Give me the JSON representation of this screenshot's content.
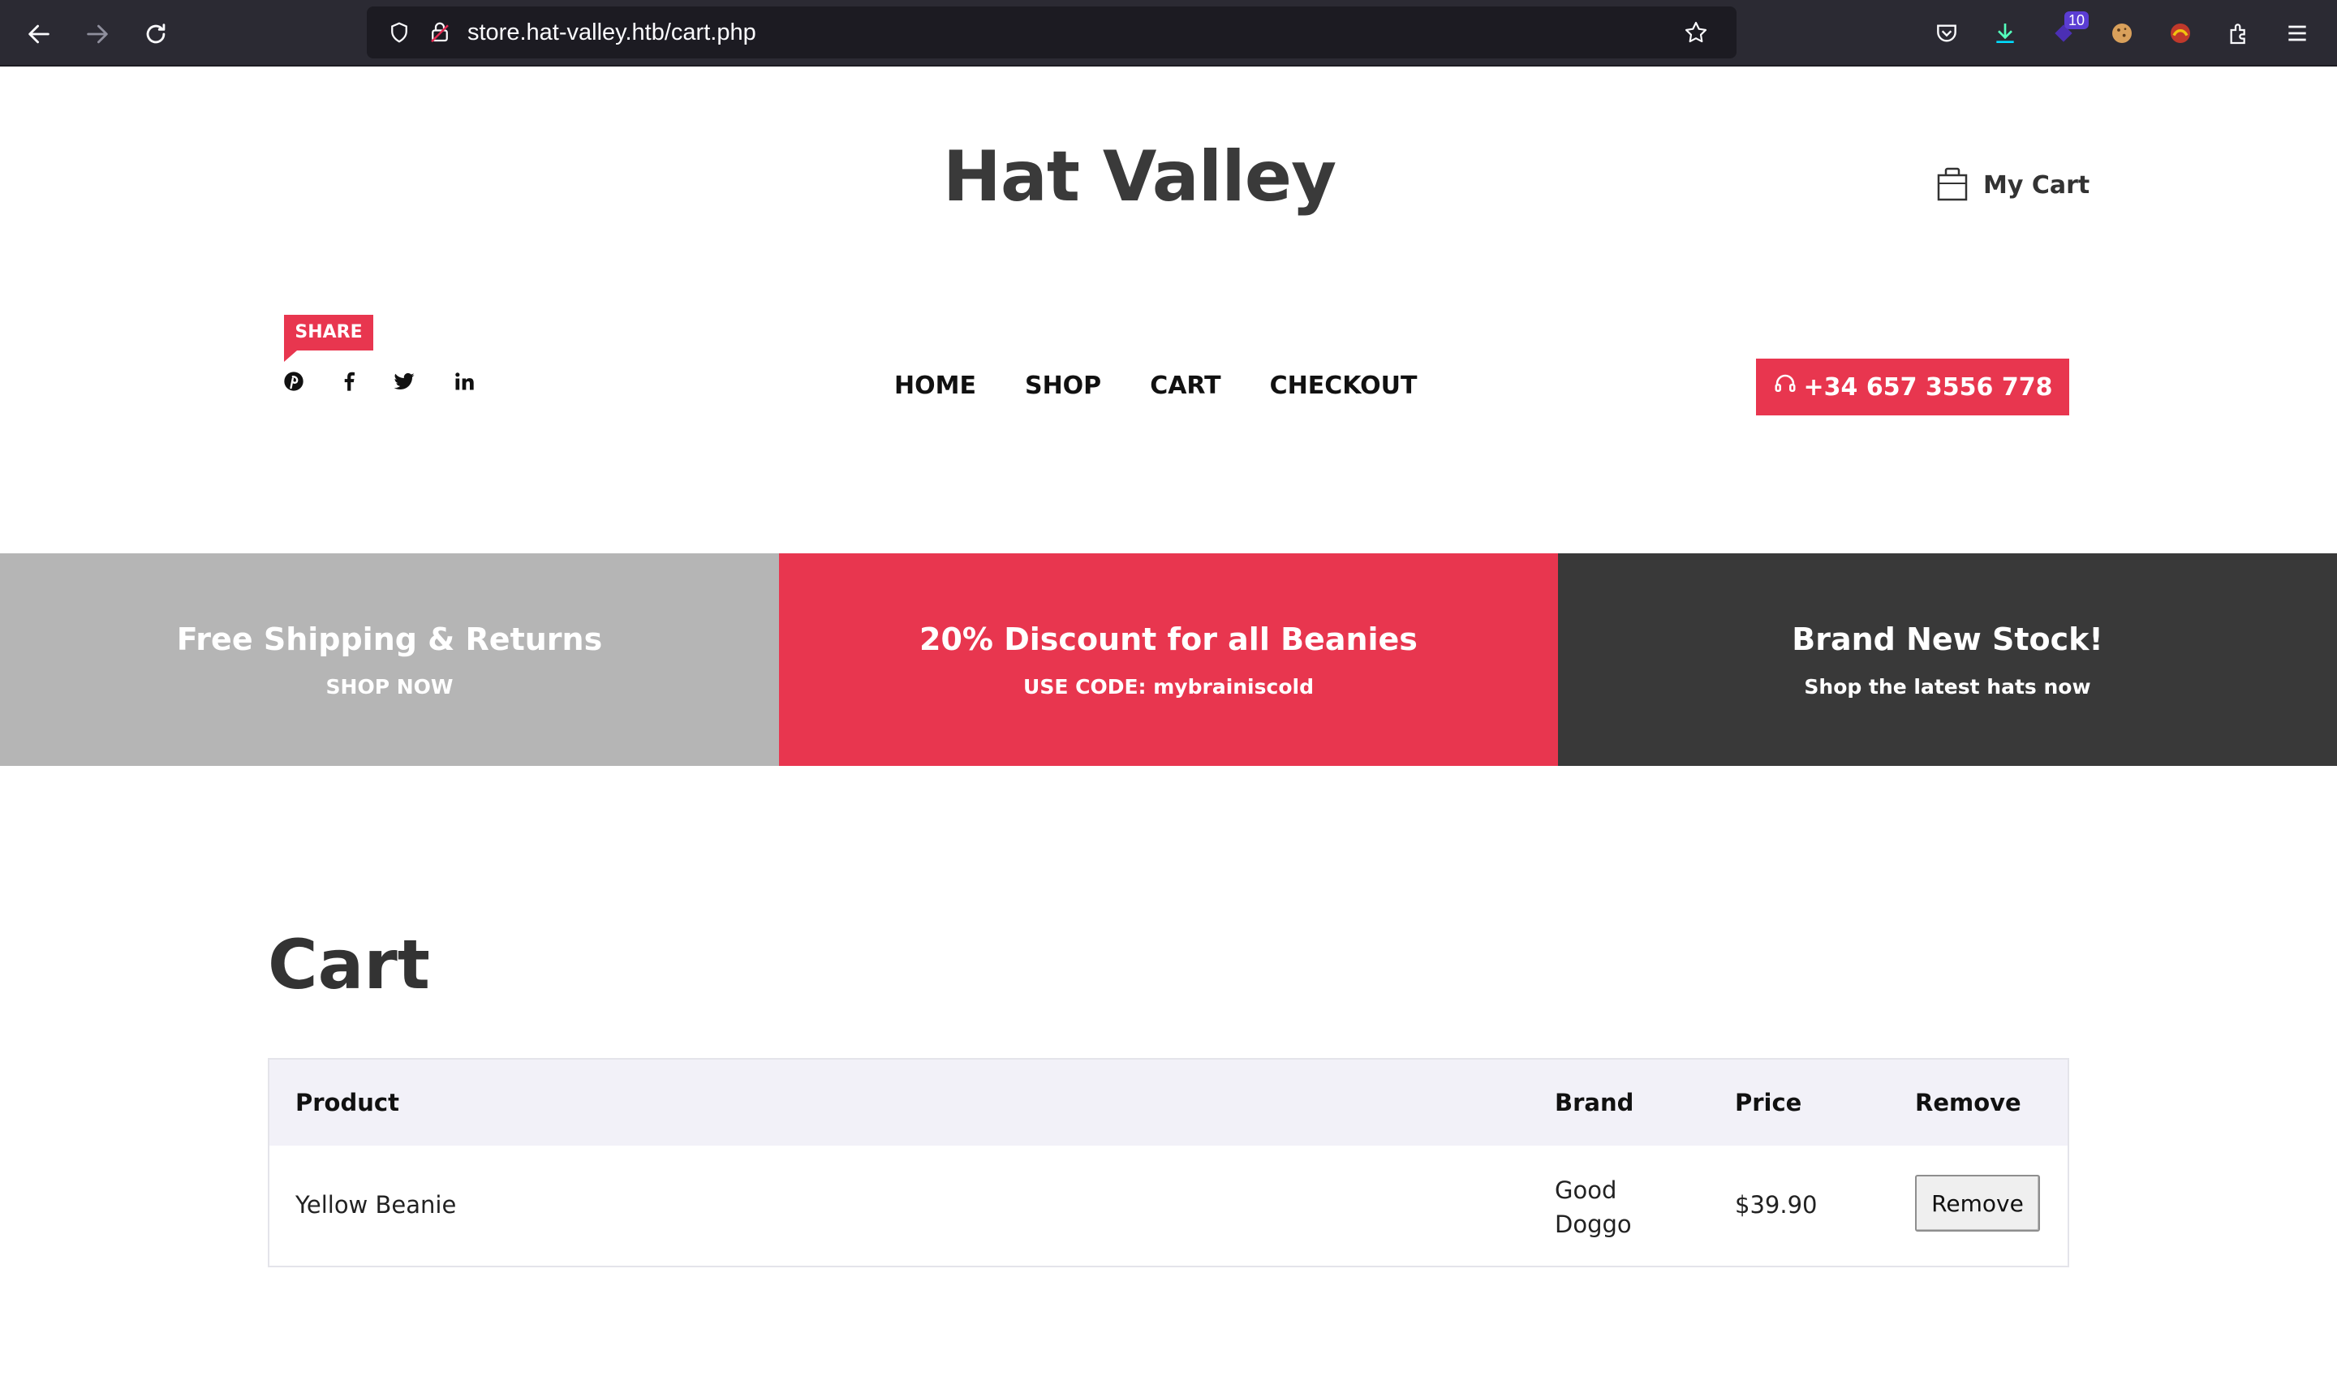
{
  "browser": {
    "url": "store.hat-valley.htb/cart.php",
    "extension_badge": "10",
    "icons": [
      "back-arrow-icon",
      "forward-arrow-icon",
      "reload-icon",
      "shield-icon",
      "lock-icon",
      "star-icon",
      "pocket-icon",
      "download-icon",
      "extension-icon",
      "cookie-icon",
      "extension-icon",
      "puzzle-icon",
      "menu-icon"
    ]
  },
  "header": {
    "site_title": "Hat Valley",
    "my_cart": "My Cart",
    "share": "SHARE",
    "social_icons": [
      "pinterest-icon",
      "facebook-icon",
      "twitter-icon",
      "linkedin-icon"
    ],
    "nav": [
      "HOME",
      "SHOP",
      "CART",
      "CHECKOUT"
    ],
    "phone": "+34 657 3556 778"
  },
  "promos": [
    {
      "title": "Free Shipping & Returns",
      "subtitle": "SHOP NOW",
      "color": "#b5b5b5"
    },
    {
      "title": "20% Discount for all Beanies",
      "subtitle": "USE CODE: mybrainiscold",
      "color": "#e8364f"
    },
    {
      "title": "Brand New Stock!",
      "subtitle": "Shop the latest hats now",
      "color": "#393939"
    }
  ],
  "cart": {
    "heading": "Cart",
    "columns": [
      "Product",
      "Brand",
      "Price",
      "Remove"
    ],
    "rows": [
      {
        "product": "Yellow Beanie",
        "brand_line1": "Good",
        "brand_line2": "Doggo",
        "price": "$39.90",
        "remove_label": "Remove"
      }
    ]
  },
  "colors": {
    "accent": "#e8364f",
    "chrome": "#2b2a33",
    "urlbar": "#1c1b22",
    "table_header": "#f2f1f8"
  }
}
